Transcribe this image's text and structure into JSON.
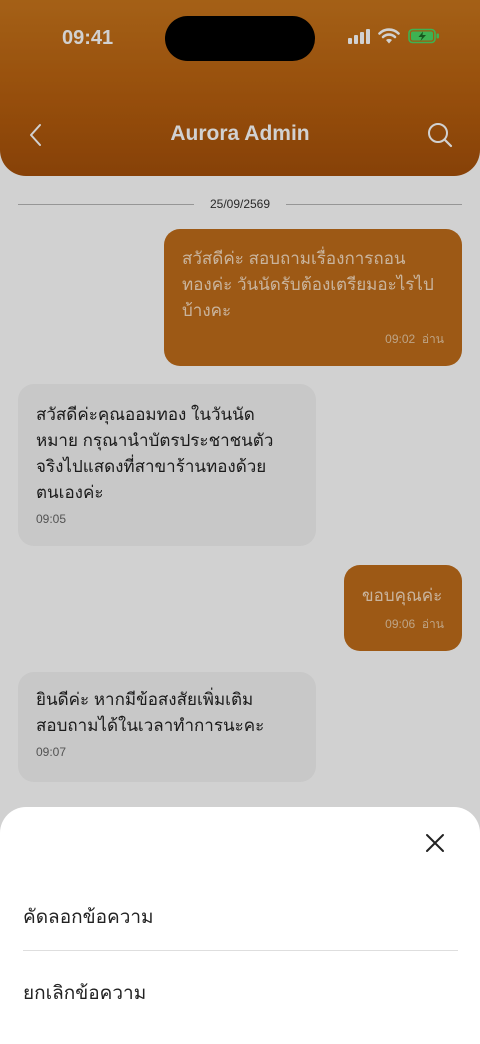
{
  "status_bar": {
    "time": "09:41"
  },
  "header": {
    "title": "Aurora Admin"
  },
  "chat": {
    "date": "25/09/2569",
    "messages": [
      {
        "direction": "out",
        "text": "สวัสดีค่ะ สอบถามเรื่องการถอน\nทองค่ะ วันนัดรับต้องเตรียมอะไรไป\nบ้างคะ",
        "time": "09:02",
        "status": "อ่าน"
      },
      {
        "direction": "in",
        "text": "สวัสดีค่ะคุณออมทอง ในวันนัด\nหมาย กรุณานำบัตรประชาชนตัว\nจริงไปแสดงที่สาขาร้านทองด้วย\nตนเองค่ะ",
        "time": "09:05"
      },
      {
        "direction": "out",
        "text": "ขอบคุณค่ะ",
        "time": "09:06",
        "status": "อ่าน"
      },
      {
        "direction": "in",
        "text": "ยินดีค่ะ หากมีข้อสงสัยเพิ่มเติม\nสอบถามได้ในเวลาทำการนะคะ",
        "time": "09:07"
      }
    ]
  },
  "action_sheet": {
    "items": [
      {
        "label": "คัดลอกข้อความ"
      },
      {
        "label": "ยกเลิกข้อความ"
      }
    ]
  },
  "colors": {
    "header_top": "#c9761c",
    "header_bottom": "#a5500a",
    "outgoing_bubble": "#c06d1a",
    "incoming_bubble": "#f4f4f4"
  },
  "icons": [
    "back-icon",
    "search-icon",
    "close-icon",
    "signal-icon",
    "wifi-icon",
    "battery-icon"
  ]
}
